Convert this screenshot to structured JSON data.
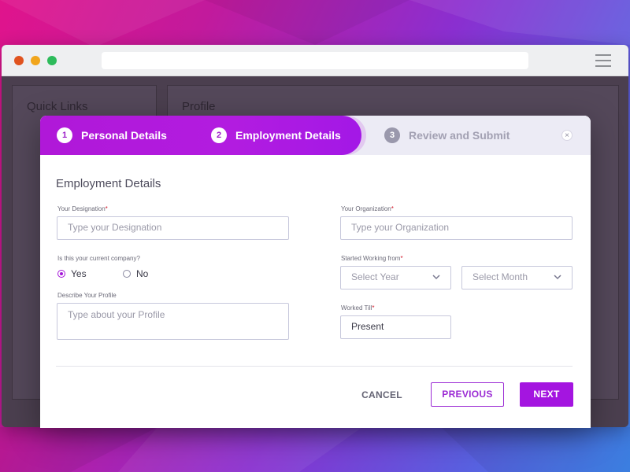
{
  "colors": {
    "accent": "#a415e0",
    "step_active_bg": "#b018d8",
    "required": "#d0182a"
  },
  "background_panels": {
    "quick_links_title": "Quick Links",
    "profile_title": "Profile"
  },
  "stepper": {
    "steps": [
      {
        "number": "1",
        "label": "Personal Details",
        "state": "active"
      },
      {
        "number": "2",
        "label": "Employment Details",
        "state": "active"
      },
      {
        "number": "3",
        "label": "Review and Submit",
        "state": "inactive"
      }
    ],
    "close_icon": "×"
  },
  "form": {
    "section_title": "Employment Details",
    "designation": {
      "label": "Your Designation",
      "required_mark": "*",
      "placeholder": "Type your Designation"
    },
    "organization": {
      "label": "Your Organization",
      "required_mark": "*",
      "placeholder": "Type your Organization"
    },
    "current_company": {
      "label": "Is this your current company?",
      "options": [
        {
          "label": "Yes",
          "checked": true
        },
        {
          "label": "No",
          "checked": false
        }
      ]
    },
    "started_from": {
      "label": "Started Working from",
      "required_mark": "*",
      "year_placeholder": "Select Year",
      "month_placeholder": "Select Month"
    },
    "profile": {
      "label": "Describe Your Profile",
      "placeholder": "Type about your Profile"
    },
    "worked_till": {
      "label": "Worked Till",
      "required_mark": "*",
      "value": "Present"
    }
  },
  "actions": {
    "cancel": "CANCEL",
    "previous": "PREVIOUS",
    "next": "NEXT"
  }
}
